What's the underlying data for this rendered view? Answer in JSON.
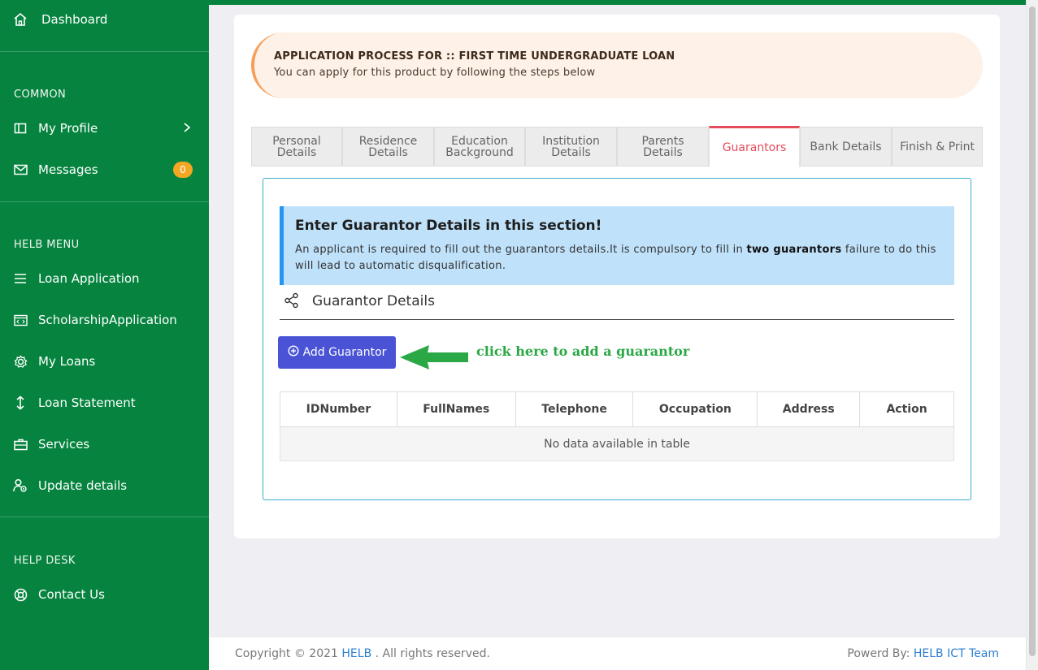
{
  "sidebar": {
    "dashboard": "Dashboard",
    "common_header": "COMMON",
    "my_profile": "My Profile",
    "messages": "Messages",
    "messages_count": "0",
    "helb_menu_header": "HELB MENU",
    "loan_application": "Loan Application",
    "scholarship_application": "ScholarshipApplication",
    "my_loans": "My Loans",
    "loan_statement": "Loan Statement",
    "services": "Services",
    "update_details": "Update details",
    "help_desk_header": "HELP DESK",
    "contact_us": "Contact Us"
  },
  "process": {
    "title": "APPLICATION PROCESS FOR :: FIRST TIME UNDERGRADUATE LOAN",
    "subtitle": "You can apply for this product by following the steps below"
  },
  "tabs": [
    {
      "l1": "Personal",
      "l2": "Details"
    },
    {
      "l1": "Residence",
      "l2": "Details"
    },
    {
      "l1": "Education",
      "l2": "Background"
    },
    {
      "l1": "Institution",
      "l2": "Details"
    },
    {
      "l1": "Parents",
      "l2": "Details"
    },
    {
      "l1": "Guarantors",
      "l2": ""
    },
    {
      "l1": "Bank Details",
      "l2": ""
    },
    {
      "l1": "Finish & Print",
      "l2": ""
    }
  ],
  "info": {
    "heading": "Enter Guarantor Details in this section!",
    "text_before": "An applicant is required to fill out the guarantors details.It is compulsory to fill in ",
    "text_bold": "two guarantors",
    "text_after": " failure to do this will lead to automatic disqualification."
  },
  "section_title": "Guarantor Details",
  "add_button": "Add Guarantor",
  "hint": "click here to add a guarantor",
  "table": {
    "headers": [
      "IDNumber",
      "FullNames",
      "Telephone",
      "Occupation",
      "Address",
      "Action"
    ],
    "empty": "No data available in table"
  },
  "footer": {
    "copyright": "Copyright © 2021 ",
    "org": "HELB",
    "rights": " . All rights reserved.",
    "powered_label": "Powerd By: ",
    "team": "HELB ICT Team"
  },
  "colors": {
    "sidebar": "#06843f",
    "accent_tab": "#e44b5c",
    "button": "#4a53d6",
    "hint": "#2aa845"
  }
}
